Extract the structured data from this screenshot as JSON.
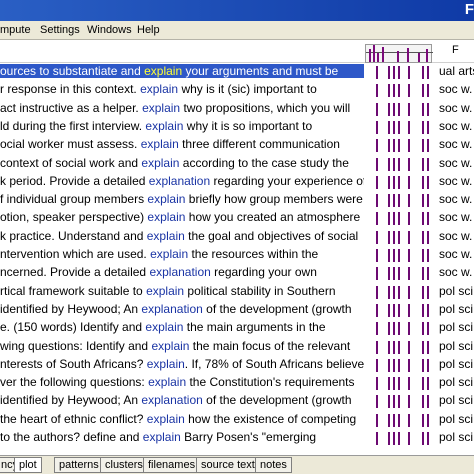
{
  "window": {
    "title_fragment": "F"
  },
  "menu": [
    "mpute",
    "Settings",
    "Windows",
    "Help"
  ],
  "header": {
    "right_label": "F"
  },
  "rows": [
    {
      "left": "ources to substantiate and ",
      "kw": "explain",
      "right": " your arguments and must be",
      "cat": "ual arts.",
      "selected": true
    },
    {
      "left": "r response in this context. ",
      "kw": "explain",
      "right": " why is it (sic) important to",
      "cat": "soc w."
    },
    {
      "left": "act instructive as a helper. ",
      "kw": "explain",
      "right": " two propositions, which you will",
      "cat": "soc w."
    },
    {
      "left": "ld during the first interview. ",
      "kw": "explain",
      "right": " why it is so important to",
      "cat": "soc w."
    },
    {
      "left": "ocial worker must assess. ",
      "kw": "explain",
      "right": " three different communication",
      "cat": "soc w."
    },
    {
      "left": "context of social work and ",
      "kw": "explain",
      "right": " according to the case study the",
      "cat": "soc w."
    },
    {
      "left": "k period. Provide a detailed ",
      "kw": "explanation",
      "right": " regarding your experience of",
      "cat": "soc w."
    },
    {
      "left": "f individual group members ",
      "kw": "explain",
      "right": " briefly how group members were",
      "cat": "soc w."
    },
    {
      "left": "otion, speaker perspective) ",
      "kw": "explain",
      "right": " how you created an atmosphere",
      "cat": "soc w."
    },
    {
      "left": "k practice. Understand and ",
      "kw": "explain",
      "right": " the goal and objectives of social",
      "cat": "soc w."
    },
    {
      "left": "ntervention which are used. ",
      "kw": "explain",
      "right": " the resources within the",
      "cat": "soc w."
    },
    {
      "left": "ncerned. Provide a detailed ",
      "kw": "explanation",
      "right": " regarding your own",
      "cat": "soc w."
    },
    {
      "left": "rtical framework suitable to ",
      "kw": "explain",
      "right": " political stability in Southern",
      "cat": "pol sci."
    },
    {
      "left": "identified by Heywood; An ",
      "kw": "explanation",
      "right": " of the development (growth",
      "cat": "pol sci."
    },
    {
      "left": "e. (150 words) Identify and ",
      "kw": "explain",
      "right": " the main arguments in the",
      "cat": "pol sci."
    },
    {
      "left": "wing questions: Identify and ",
      "kw": "explain",
      "right": " the main focus of the relevant",
      "cat": "pol sci."
    },
    {
      "left": "nterests of South Africans? ",
      "kw": "explain",
      "right": ". If, 78% of South Africans believe",
      "cat": "pol sci."
    },
    {
      "left": "ver the following questions: ",
      "kw": "explain",
      "right": " the Constitution's requirements",
      "cat": "pol sci."
    },
    {
      "left": "identified by Heywood; An ",
      "kw": "explanation",
      "right": " of the development (growth",
      "cat": "pol sci."
    },
    {
      "left": "the heart of ethnic conflict? ",
      "kw": "explain",
      "right": " how the existence of competing",
      "cat": "pol sci."
    },
    {
      "left": "to the authors? define and ",
      "kw": "explain",
      "right": " Barry Posen's \"emerging",
      "cat": "pol sci."
    }
  ],
  "tabs": [
    "ncy",
    "plot",
    "patterns",
    "clusters",
    "filenames",
    "source text",
    "notes"
  ],
  "active_tab": "plot",
  "colors": {
    "titlebar": "#1f4fb8",
    "keyword": "#1a34a4",
    "selection": "#2e58c8",
    "bar": "#6c0a72"
  }
}
